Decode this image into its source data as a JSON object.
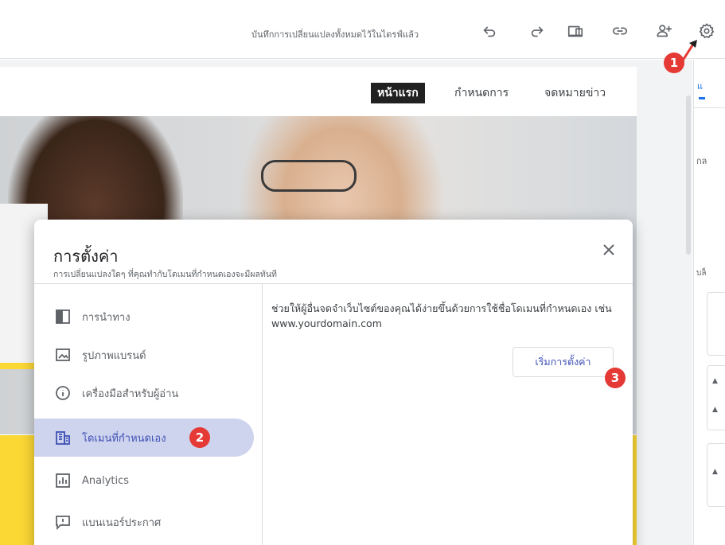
{
  "toolbar": {
    "save_status": "บันทึกการเปลี่ยนแปลงทั้งหมดไว้ในไดรฟ์แล้ว",
    "icons": [
      "undo-icon",
      "redo-icon",
      "preview-icon",
      "link-icon",
      "share-icon",
      "settings-icon"
    ]
  },
  "site": {
    "nav": [
      {
        "label": "หน้าแรก"
      },
      {
        "label": "กำหนดการ"
      },
      {
        "label": "จดหมายข่าว"
      }
    ]
  },
  "right_panel": {
    "tab_label": "แ",
    "text1": "กล",
    "text2": "บล็"
  },
  "settings_dialog": {
    "title": "การตั้งค่า",
    "subtitle": "การเปลี่ยนแปลงใดๆ ที่คุณทำกับโดเมนที่กำหนดเองจะมีผลทันที",
    "menu": [
      {
        "label": "การนำทาง",
        "icon": "navigation-icon"
      },
      {
        "label": "รูปภาพแบรนด์",
        "icon": "brand-image-icon"
      },
      {
        "label": "เครื่องมือสำหรับผู้อ่าน",
        "icon": "info-icon"
      },
      {
        "label": "โดเมนที่กำหนดเอง",
        "icon": "domain-icon",
        "selected": true
      },
      {
        "label": "Analytics",
        "icon": "analytics-icon"
      },
      {
        "label": "แบนเนอร์ประกาศ",
        "icon": "announcement-icon"
      }
    ],
    "description": "ช่วยให้ผู้อื่นจดจำเว็บไซต์ของคุณได้ง่ายขึ้นด้วยการใช้ชื่อโดเมนที่กำหนดเอง เช่น www.yourdomain.com",
    "start_button": "เริ่มการตั้งค่า"
  },
  "annotations": {
    "step1": "1",
    "step2": "2",
    "step3": "3"
  },
  "colors": {
    "accent": "#3f51b5",
    "selected_bg": "#cfd4ee",
    "badge": "#e53935",
    "banner_yellow": "#fcd835"
  }
}
